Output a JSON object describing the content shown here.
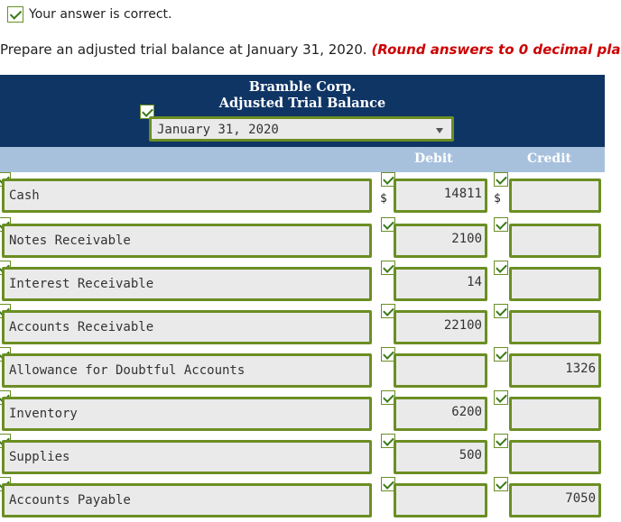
{
  "status": {
    "text": "Your answer is correct."
  },
  "instruction": {
    "text": "Prepare an adjusted trial balance at January 31, 2020.",
    "round_note": "(Round answers to 0 decimal pla"
  },
  "header": {
    "company": "Bramble Corp.",
    "title": "Adjusted Trial Balance",
    "date": "January 31, 2020"
  },
  "columns": {
    "debit": "Debit",
    "credit": "Credit"
  },
  "currency_symbol": "$",
  "rows": [
    {
      "account": "Cash",
      "debit": "14811",
      "credit": ""
    },
    {
      "account": "Notes Receivable",
      "debit": "2100",
      "credit": ""
    },
    {
      "account": "Interest Receivable",
      "debit": "14",
      "credit": ""
    },
    {
      "account": "Accounts Receivable",
      "debit": "22100",
      "credit": ""
    },
    {
      "account": "Allowance for Doubtful Accounts",
      "debit": "",
      "credit": "1326"
    },
    {
      "account": "Inventory",
      "debit": "6200",
      "credit": ""
    },
    {
      "account": "Supplies",
      "debit": "500",
      "credit": ""
    },
    {
      "account": "Accounts Payable",
      "debit": "",
      "credit": "7050"
    }
  ]
}
